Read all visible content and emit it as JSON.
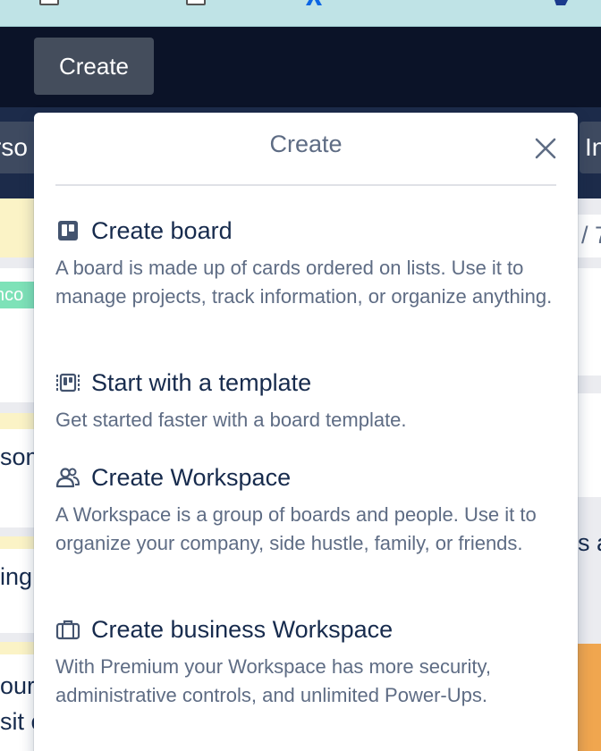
{
  "header": {
    "create_label": "Create"
  },
  "board_bar": {
    "left_fragment": "rso",
    "right_fragment": "In"
  },
  "background": {
    "label_fragment": "nco",
    "text_fragments": [
      "som",
      "ing",
      "our",
      "sit c",
      "s a",
      "/ 7"
    ]
  },
  "popover": {
    "title": "Create",
    "close_icon": "close-icon",
    "items": [
      {
        "icon": "board-icon",
        "title": "Create board",
        "description": "A board is made up of cards ordered on lists. Use it to manage projects, track information, or organize anything."
      },
      {
        "icon": "template-icon",
        "title": "Start with a template",
        "description": "Get started faster with a board template."
      },
      {
        "icon": "workspace-icon",
        "title": "Create Workspace",
        "description": "A Workspace is a group of boards and people. Use it to organize your company, side hustle, family, or friends."
      },
      {
        "icon": "briefcase-icon",
        "title": "Create business Workspace",
        "description": "With Premium your Workspace has more security, administrative controls, and unlimited Power-Ups."
      }
    ]
  },
  "colors": {
    "header_bg": "#0b1328",
    "board_bar_bg": "#1c2b4a",
    "title_text": "#172b4d",
    "muted_text": "#5e6c84",
    "accent_blue": "#0c66e4"
  }
}
